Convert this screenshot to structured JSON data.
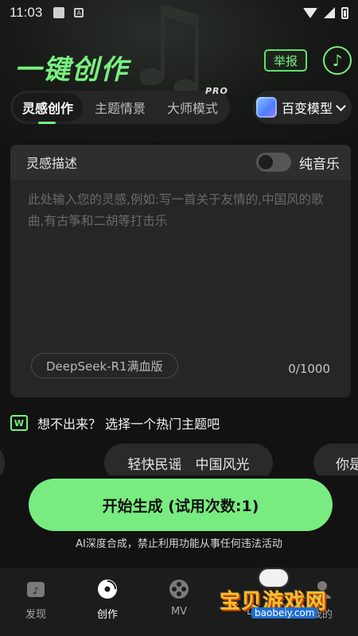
{
  "status_bar": {
    "time": "11:03"
  },
  "header": {
    "title": "一键创作",
    "report_label": "举报",
    "music_icon": "music-note-icon"
  },
  "tabs": [
    {
      "label": "灵感创作",
      "active": true
    },
    {
      "label": "主题情景",
      "active": false
    },
    {
      "label": "大师模式",
      "active": false,
      "badge": "PRO"
    }
  ],
  "model_selector": {
    "label": "百变模型"
  },
  "inspiration_card": {
    "title": "灵感描述",
    "toggle_label": "纯音乐",
    "toggle_on": false,
    "prompt_value": "",
    "prompt_placeholder": "此处输入您的灵感,例如:写一首关于友情的,中国风的歌曲,有古筝和二胡等打击乐",
    "model_chip": "DeepSeek-R1满血版",
    "counter": "0/1000"
  },
  "hint": {
    "icon_letter": "W",
    "text": "想不出来？ 选择一个热门主题吧"
  },
  "topic_chips": [
    {
      "label": ""
    },
    {
      "label": "轻快民谣　中国风光"
    },
    {
      "label": "你是"
    }
  ],
  "generate": {
    "label": "开始生成 (试用次数:1)",
    "disclaimer": "AI深度合成，禁止利用功能从事任何违法活动"
  },
  "bottom_nav": [
    {
      "label": "发现",
      "icon": "discover-icon",
      "active": false
    },
    {
      "label": "创作",
      "icon": "disc-icon",
      "active": true
    },
    {
      "label": "MV",
      "icon": "film-reel-icon",
      "active": false
    },
    {
      "label": "D",
      "icon": "",
      "active": false
    },
    {
      "label": "我的",
      "icon": "profile-icon",
      "active": false
    }
  ],
  "watermark": {
    "text": "宝贝游戏网",
    "url": "baobeiy.com"
  },
  "colors": {
    "accent": "#79f07f",
    "button": "#78ec80",
    "background": "#121212",
    "card": "#262626"
  }
}
